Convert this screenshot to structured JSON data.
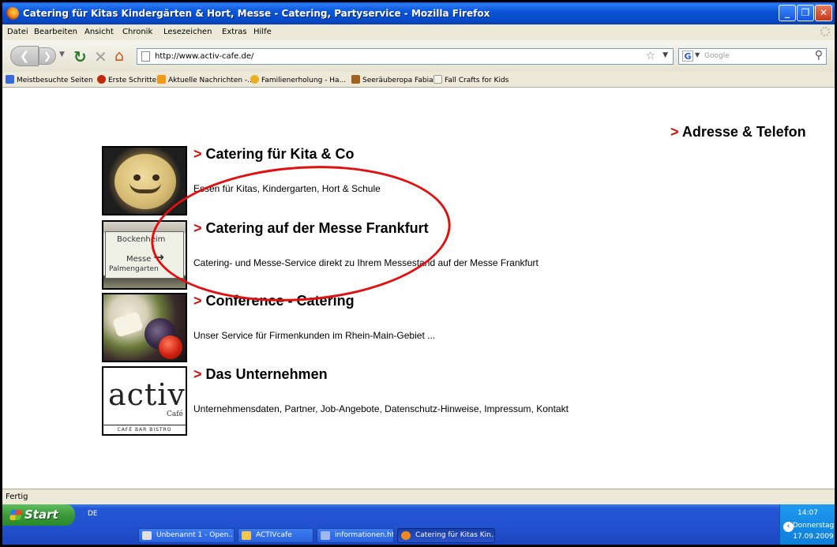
{
  "window": {
    "title": "Catering für Kitas Kindergärten & Hort, Messe - Catering, Partyservice - Mozilla Firefox"
  },
  "menu": {
    "items": [
      "Datei",
      "Bearbeiten",
      "Ansicht",
      "Chronik",
      "Lesezeichen",
      "Extras",
      "Hilfe"
    ]
  },
  "navigation": {
    "url": "http://www.activ-cafe.de/",
    "search_placeholder": "Google"
  },
  "bookmarks": {
    "items": [
      {
        "label": "Meistbesuchte Seiten",
        "icon": "most-visited-icon",
        "color": "#3a6ad8"
      },
      {
        "label": "Erste Schritte",
        "icon": "firefox-icon",
        "color": "#c02a0a"
      },
      {
        "label": "Aktuelle Nachrichten -...",
        "icon": "rss-feed-icon",
        "color": "#f09a1a"
      },
      {
        "label": "Familienerholung - Ha...",
        "icon": "page-icon",
        "color": "#e8b020"
      },
      {
        "label": "Seeräuberopa Fabian",
        "icon": "bird-icon",
        "color": "#a06020"
      },
      {
        "label": "Fall Crafts for Kids",
        "icon": "document-icon",
        "color": "#d8d4b8"
      }
    ]
  },
  "content": {
    "address_link": "Adresse & Telefon",
    "arrow": ">",
    "sections": [
      {
        "title": "Catering für Kita & Co",
        "description": "Essen für Kitas, Kindergarten, Hort & Schule"
      },
      {
        "title": "Catering auf der Messe Frankfurt",
        "description": "Catering- und Messe-Service direkt zu Ihrem Messestand auf der Messe Frankfurt"
      },
      {
        "title": "Conference - Catering",
        "description": "Unser Service für Firmenkunden im Rhein-Main-Gebiet ..."
      },
      {
        "title": "Das Unternehmen",
        "description": "Unternehmensdaten, Partner, Job-Angebote, Datenschutz-Hinweise, Impressum, Kontakt"
      }
    ],
    "sign_text": {
      "line1": "Bockenheim",
      "line2": "Messe",
      "line3": "Palmengarten"
    },
    "logo_text": {
      "main": "activ",
      "sub": "Café",
      "tagline": "CAFÉ BAR BISTRO"
    }
  },
  "status": {
    "text": "Fertig"
  },
  "taskbar": {
    "start_label": "Start",
    "language": "DE",
    "tasks": [
      {
        "label": "Unbenannt 1 - Open...",
        "icon": "openoffice-icon",
        "color": "#e0e0e0",
        "active": false
      },
      {
        "label": "ACTIVcafe",
        "icon": "folder-icon",
        "color": "#f0c850",
        "active": false
      },
      {
        "label": "informationen.html - ...",
        "icon": "html-file-icon",
        "color": "#a0b8f0",
        "active": false
      },
      {
        "label": "Catering für Kitas Kin...",
        "icon": "firefox-icon",
        "color": "#f08a1c",
        "active": true
      }
    ],
    "clock": {
      "time": "14:07",
      "day": "Donnerstag",
      "date": "17.09.2009"
    }
  },
  "colors": {
    "arrow": "#cc1010",
    "annotation": "#e01010",
    "titlebar": "#0b56d8"
  }
}
